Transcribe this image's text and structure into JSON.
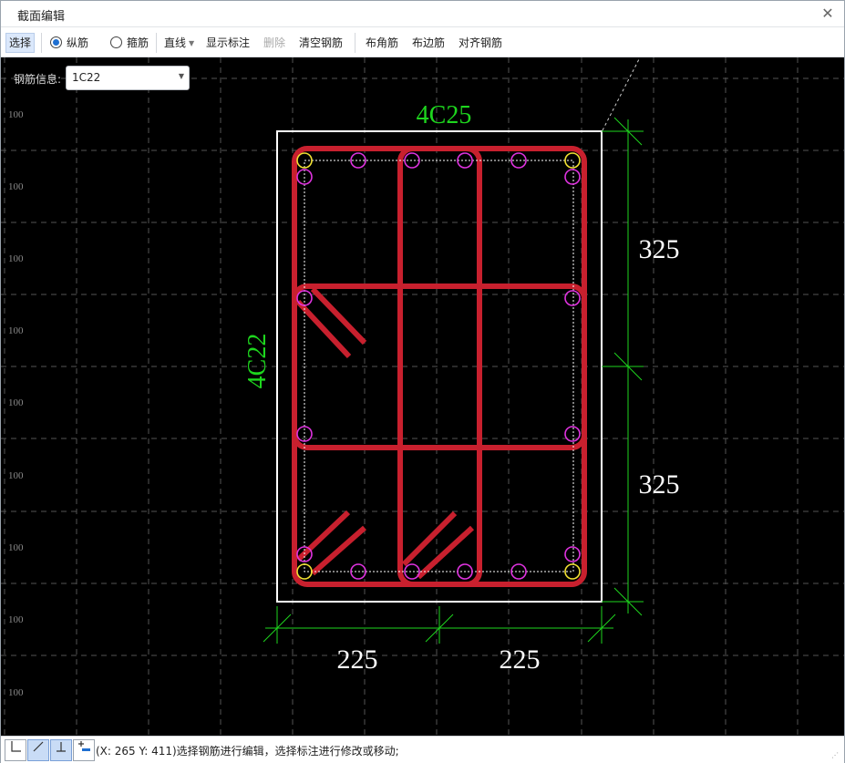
{
  "window": {
    "title": "截面编辑",
    "close_label": "✕"
  },
  "toolbar": {
    "select_label": "选择",
    "longitudinal_label": "纵筋",
    "stirrup_label": "箍筋",
    "line_label": "直线",
    "show_dims_label": "显示标注",
    "delete_label": "删除",
    "clear_label": "清空钢筋",
    "corner_label": "布角筋",
    "edge_label": "布边筋",
    "align_label": "对齐钢筋",
    "mode_selected": "纵筋"
  },
  "rebar_info": {
    "label": "钢筋信息:",
    "value": "1C22"
  },
  "canvas": {
    "grid_labels": [
      "100",
      "100",
      "100",
      "100",
      "100",
      "100",
      "100",
      "100",
      "100"
    ],
    "top_rebar_label": "4C25",
    "left_rebar_label": "4C22",
    "dim_right": [
      "325",
      "325"
    ],
    "dim_bottom": [
      "225",
      "225"
    ],
    "colors": {
      "background": "#000000",
      "stirrup": "#c8202e",
      "rebar_corner": "#f2e233",
      "rebar_edge": "#e033e0",
      "dimension": "#1ed61e",
      "outline": "#ffffff"
    }
  },
  "status": {
    "text": "(X: 265 Y: 411)选择钢筋进行编辑，选择标注进行修改或移动;",
    "buttons": [
      "ortho-icon",
      "line-draw-icon",
      "perpendicular-icon",
      "add-dimension-icon"
    ]
  }
}
